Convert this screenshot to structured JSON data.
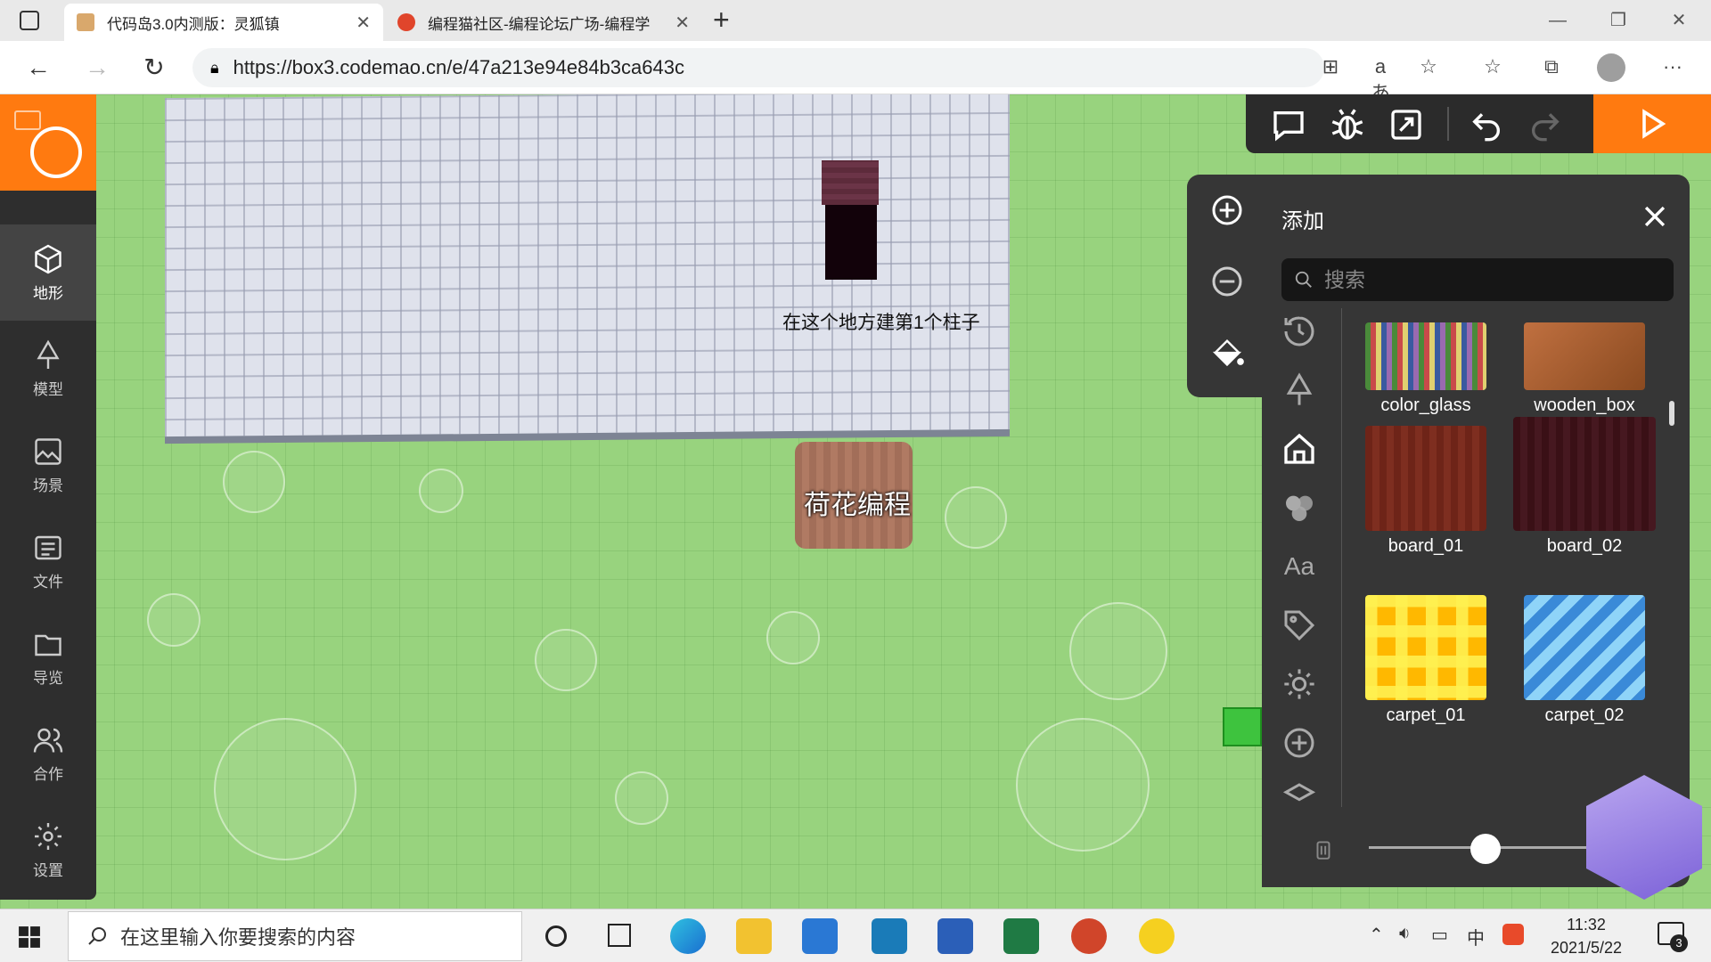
{
  "browser": {
    "tabs": [
      {
        "title": "代码岛3.0内测版：灵狐镇",
        "active": true
      },
      {
        "title": "编程猫社区-编程论坛广场-编程学",
        "active": false
      }
    ],
    "new_tab": "+",
    "url": "https://box3.codemao.cn/e/47a213e94e84b3ca643c",
    "window_controls": {
      "minimize": "—",
      "restore": "❐",
      "close": "✕"
    }
  },
  "sidebar": {
    "items": [
      {
        "label": "地形",
        "icon": "cube-icon",
        "active": true
      },
      {
        "label": "模型",
        "icon": "tree-icon",
        "active": false
      },
      {
        "label": "场景",
        "icon": "image-icon",
        "active": false
      },
      {
        "label": "文件",
        "icon": "file-icon",
        "active": false
      },
      {
        "label": "导览",
        "icon": "folder-icon",
        "active": false
      },
      {
        "label": "合作",
        "icon": "users-icon",
        "active": false
      },
      {
        "label": "设置",
        "icon": "gear-icon",
        "active": false
      }
    ]
  },
  "scene": {
    "hint": "在这个地方建第1个柱子",
    "player_name": "荷花编程"
  },
  "add_panel": {
    "title": "添加",
    "search_placeholder": "搜索",
    "blocks": [
      {
        "name": "color_glass"
      },
      {
        "name": "wooden_box"
      },
      {
        "name": "board_01"
      },
      {
        "name": "board_02"
      },
      {
        "name": "carpet_01"
      },
      {
        "name": "carpet_02"
      }
    ]
  },
  "taskbar": {
    "search_placeholder": "在这里输入你要搜索的内容",
    "time": "11:32",
    "date": "2021/5/22",
    "ime": "中",
    "notifications": "3"
  }
}
